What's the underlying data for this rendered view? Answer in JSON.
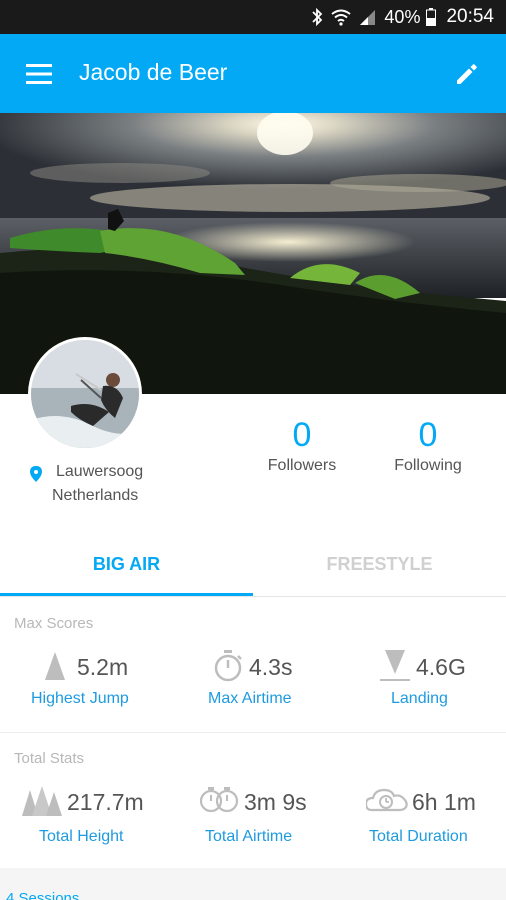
{
  "status_bar": {
    "battery": "40%",
    "time": "20:54"
  },
  "app_bar": {
    "title": "Jacob de Beer"
  },
  "profile": {
    "location_city": "Lauwersoog",
    "location_country": "Netherlands",
    "followers_count": "0",
    "followers_label": "Followers",
    "following_count": "0",
    "following_label": "Following"
  },
  "tabs": [
    {
      "label": "BIG AIR",
      "active": true
    },
    {
      "label": "FREESTYLE",
      "active": false
    }
  ],
  "max_scores": {
    "label": "Max Scores",
    "items": [
      {
        "value": "5.2m",
        "caption": "Highest Jump",
        "icon": "mountain-icon"
      },
      {
        "value": "4.3s",
        "caption": "Max Airtime",
        "icon": "stopwatch-icon"
      },
      {
        "value": "4.6G",
        "caption": "Landing",
        "icon": "landing-icon"
      }
    ]
  },
  "total_stats": {
    "label": "Total Stats",
    "items": [
      {
        "value": "217.7m",
        "caption": "Total Height",
        "icon": "mountains-icon"
      },
      {
        "value": "3m 9s",
        "caption": "Total Airtime",
        "icon": "double-stopwatch-icon"
      },
      {
        "value": "6h 1m",
        "caption": "Total Duration",
        "icon": "clock-cloud-icon"
      }
    ]
  },
  "sessions": {
    "label": "4 Sessions"
  },
  "colors": {
    "accent": "#03a9f4",
    "caption": "#1e9be0",
    "muted": "#b8b8b8"
  }
}
